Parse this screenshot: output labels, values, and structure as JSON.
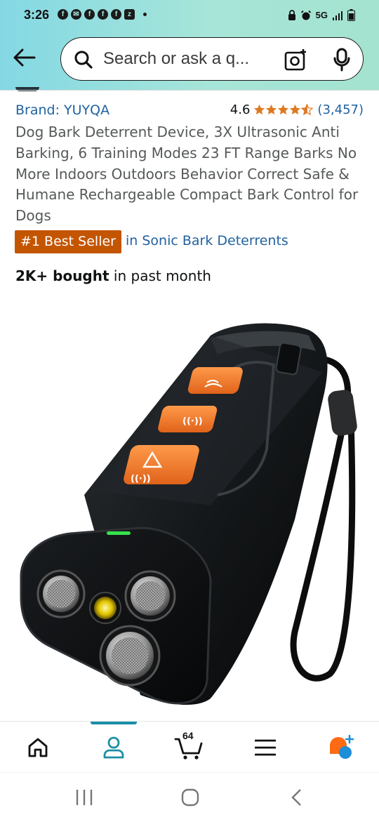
{
  "status_bar": {
    "time": "3:26",
    "notification_icons": [
      "f",
      "f",
      "f",
      "f",
      "f",
      "z"
    ],
    "network": "5G"
  },
  "search": {
    "placeholder": "Search or ask a q..."
  },
  "product": {
    "brand": "Brand: YUYQA",
    "rating_value": "4.6",
    "rating_stars": 4.6,
    "rating_count": "(3,457)",
    "title": "Dog Bark Deterrent Device, 3X Ultrasonic Anti Barking, 6 Training Modes 23 FT Range Barks No More Indoors Outdoors Behavior Correct Safe & Humane Rechargeable Compact Bark Control for Dogs",
    "badge": "#1 Best Seller",
    "badge_category": "in Sonic Bark Deterrents",
    "bought_bold": "2K+ bought",
    "bought_rest": " in past month"
  },
  "bottom_nav": {
    "items": [
      "home-icon",
      "account-icon",
      "cart-icon",
      "menu-icon",
      "rufus-ai-icon"
    ],
    "active": "account-icon",
    "cart_count": "64"
  },
  "colors": {
    "header_gradient_start": "#84d8e4",
    "header_gradient_end": "#a4e3cf",
    "link": "#2162a1",
    "star": "#de7921",
    "badge": "#c45500",
    "nav_active": "#1a8fa6"
  }
}
